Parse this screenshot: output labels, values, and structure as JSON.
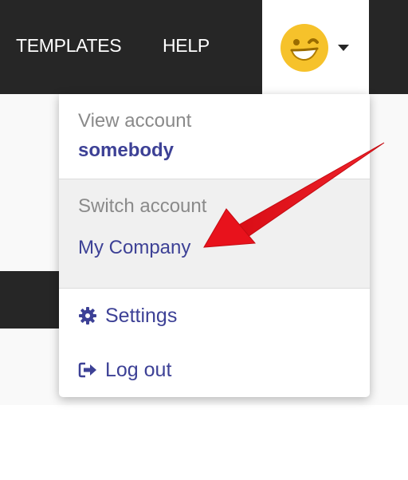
{
  "header": {
    "nav": {
      "templates": "TEMPLATES",
      "help": "HELP"
    },
    "avatar_icon": "winking-face-emoji",
    "caret_icon": "caret-down-icon"
  },
  "menu": {
    "view_account": {
      "label": "View account",
      "username": "somebody"
    },
    "switch_account": {
      "label": "Switch account",
      "account": "My Company"
    },
    "items": {
      "settings": {
        "label": "Settings",
        "icon": "gear-icon"
      },
      "logout": {
        "label": "Log out",
        "icon": "sign-out-icon"
      }
    }
  },
  "annotation": {
    "arrow_icon": "red-arrow-pointing-left",
    "color": "#e8121c"
  },
  "colors": {
    "topbar": "#262626",
    "link": "#3d4196",
    "muted": "#8a8a8a",
    "switch_bg": "#f0f0f0",
    "avatar": "#f6c22b"
  }
}
